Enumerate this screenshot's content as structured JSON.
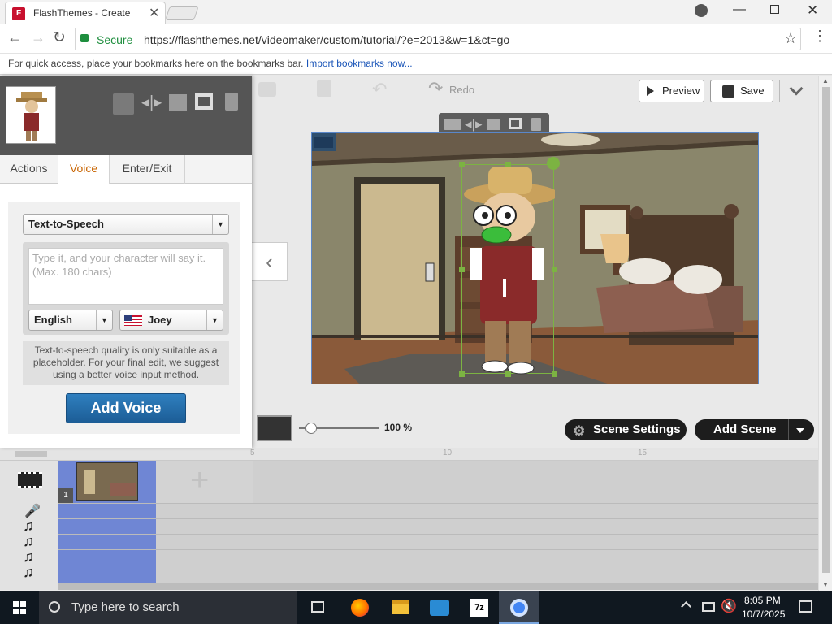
{
  "browser": {
    "tab_title": "FlashThemes - Create",
    "secure_label": "Secure",
    "url": "https://flashthemes.net/videomaker/custom/tutorial/?e=2013&w=1&ct=go",
    "bookmarks_text": "For quick access, place your bookmarks here on the bookmarks bar.",
    "bookmarks_link": "Import bookmarks now..."
  },
  "panel": {
    "tabs": [
      {
        "label": "Actions"
      },
      {
        "label": "Voice"
      },
      {
        "label": "Enter/Exit"
      }
    ],
    "active_tab": "Voice",
    "voice_type": "Text-to-Speech",
    "tts_placeholder": "Type it, and your character will say it.  (Max.  180 chars)",
    "language": "English",
    "voice_name": "Joey",
    "note": "Text-to-speech quality is only suitable as a placeholder. For your final edit, we suggest using a better voice input method.",
    "add_voice": "Add Voice"
  },
  "toolbar": {
    "redo": "Redo",
    "preview": "Preview",
    "save": "Save"
  },
  "controls": {
    "zoom_value": "100 %",
    "zoom_level": 0.1,
    "scene_settings": "Scene Settings",
    "add_scene": "Add Scene"
  },
  "timeline": {
    "ticks": [
      "5",
      "10",
      "15"
    ],
    "scene_number": "1"
  },
  "taskbar": {
    "search_placeholder": "Type here to search",
    "time": "8:05 PM",
    "date": "10/7/2025"
  },
  "colors": {
    "accent_orange": "#c86400",
    "button_blue": "#1c5d96",
    "selection_green": "#7cb342",
    "timeline_scene": "#6f86d4"
  }
}
